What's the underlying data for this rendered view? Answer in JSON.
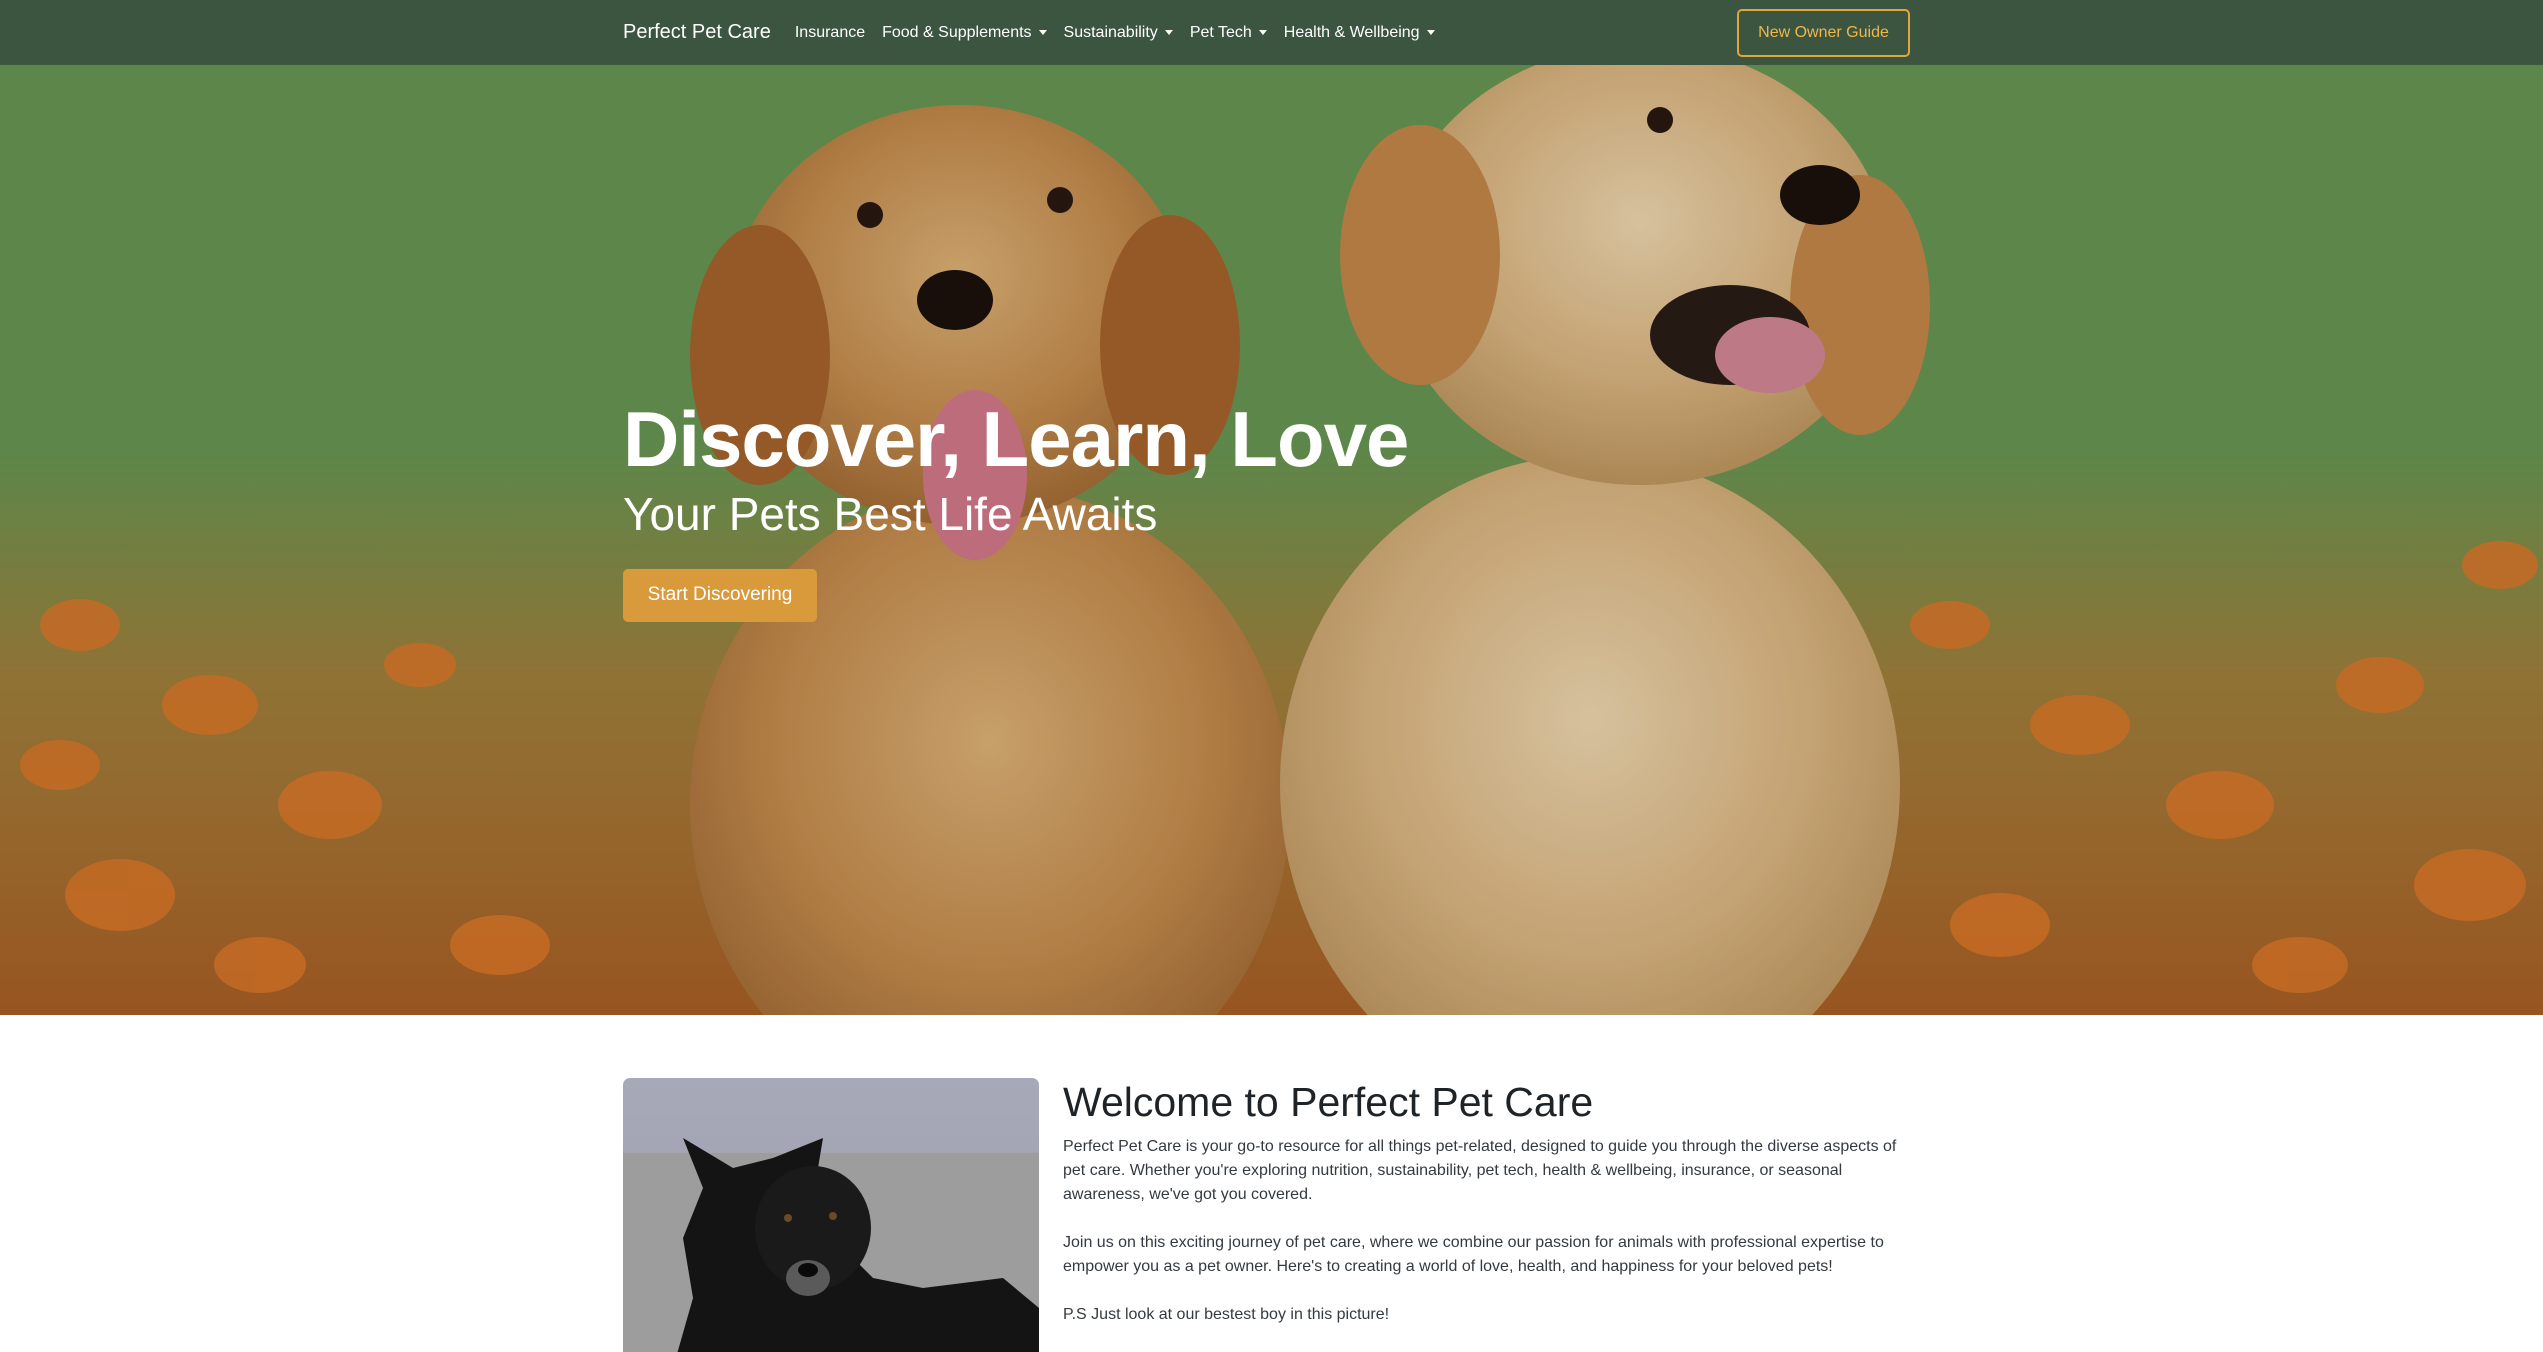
{
  "nav": {
    "brand": "Perfect Pet Care",
    "items": [
      {
        "label": "Insurance",
        "dropdown": false
      },
      {
        "label": "Food & Supplements",
        "dropdown": true
      },
      {
        "label": "Sustainability",
        "dropdown": true
      },
      {
        "label": "Pet Tech",
        "dropdown": true
      },
      {
        "label": "Health & Wellbeing",
        "dropdown": true
      }
    ],
    "guide_button": "New Owner Guide"
  },
  "hero": {
    "title": "Discover, Learn, Love",
    "subtitle": "Your Pets Best Life Awaits",
    "cta": "Start Discovering",
    "image": "two golden retriever puppies in a field of orange flowers"
  },
  "welcome": {
    "heading": "Welcome to Perfect Pet Care",
    "paragraphs": [
      "Perfect Pet Care is your go-to resource for all things pet-related, designed to guide you through the diverse aspects of pet care. Whether you're exploring nutrition, sustainability, pet tech, health & wellbeing, insurance, or seasonal awareness, we've got you covered.",
      "Join us on this exciting journey of pet care, where we combine our passion for animals with professional expertise to empower you as a pet owner. Here's to creating a world of love, health, and happiness for your beloved pets!",
      "P.S Just look at our bestest boy in this picture!"
    ],
    "image": "black dog lying on frosty ground"
  },
  "colors": {
    "navbar": "#3b5541",
    "accent": "#d99a3c",
    "guide_border": "#e0a63b"
  }
}
